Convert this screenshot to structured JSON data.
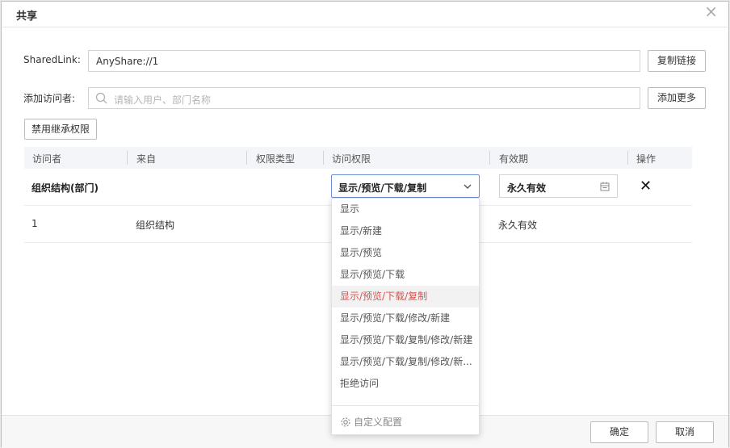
{
  "dialog": {
    "title": "共享",
    "close_symbol": "×"
  },
  "link": {
    "label": "SharedLink:",
    "value": "AnyShare://1",
    "copy_button": "复制链接"
  },
  "visitor": {
    "label": "添加访问者:",
    "placeholder": "请输入用户、部门名称",
    "more_button": "添加更多"
  },
  "disable_inherit_button": "禁用继承权限",
  "table": {
    "headers": [
      "访问者",
      "来自",
      "权限类型",
      "访问权限",
      "有效期",
      "操作"
    ],
    "rows": [
      {
        "visitor": "组织结构(部门)",
        "from": "",
        "type": "",
        "permission": "显示/预览/下载/复制",
        "expiry": "永久有效",
        "action_symbol": "✕"
      },
      {
        "visitor": "1",
        "from": "组织结构",
        "type": "",
        "permission": "",
        "expiry": "永久有效"
      }
    ]
  },
  "permission_options": [
    "显示",
    "显示/新建",
    "显示/预览",
    "显示/预览/下载",
    "显示/预览/下载/复制",
    "显示/预览/下载/修改/新建",
    "显示/预览/下载/复制/修改/新建",
    "显示/预览/下载/复制/修改/新...",
    "拒绝访问"
  ],
  "selected_option_index": 4,
  "custom_config_label": "自定义配置",
  "footer": {
    "ok_button": "确定",
    "cancel_button": "取消"
  },
  "icons": {
    "search": "search-icon",
    "chevron": "chevron-down-icon",
    "calendar": "calendar-icon",
    "gear": "gear-icon"
  },
  "colors": {
    "selected_option_text": "#d9534f",
    "select_border": "#6e8fd8"
  }
}
